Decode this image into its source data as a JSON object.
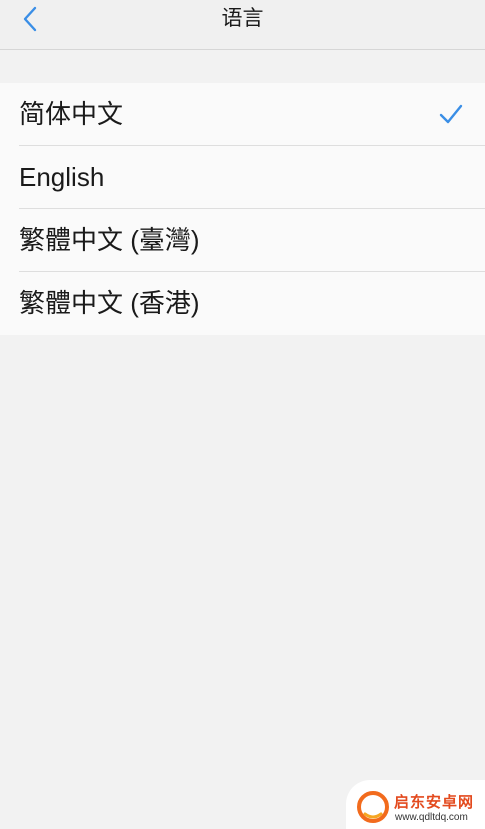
{
  "nav": {
    "title": "语言",
    "back_icon": "chevron-left-icon"
  },
  "languages": [
    {
      "label": "简体中文",
      "selected": true
    },
    {
      "label": "English",
      "selected": false
    },
    {
      "label": "繁體中文 (臺灣)",
      "selected": false
    },
    {
      "label": "繁體中文 (香港)",
      "selected": false
    }
  ],
  "check_icon": "checkmark-icon",
  "accent_color": "#3a8ee6",
  "watermark": {
    "title": "启东安卓网",
    "url": "www.qdltdq.com",
    "logo_color": "#f26b1d"
  }
}
